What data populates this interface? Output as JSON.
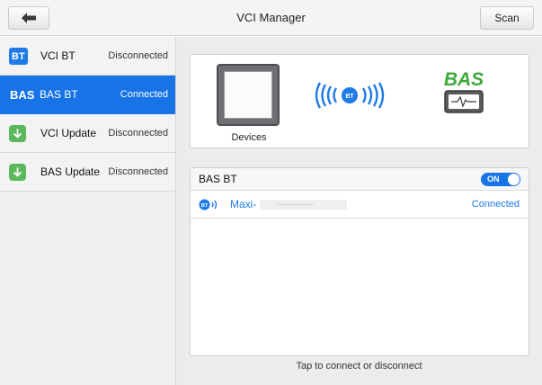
{
  "topbar": {
    "title": "VCI Manager",
    "back_icon": "arrow-left-icon",
    "scan_label": "Scan"
  },
  "sidebar": {
    "items": [
      {
        "icon_text": "BT",
        "icon": "bluetooth-badge-icon",
        "label": "VCI BT",
        "status": "Disconnected",
        "active": false
      },
      {
        "icon_text": "BAS",
        "icon": "bas-badge-icon",
        "label": "BAS BT",
        "status": "Connected",
        "active": true
      },
      {
        "icon": "download-arrow-icon",
        "label": "VCI Update",
        "status": "Disconnected",
        "active": false
      },
      {
        "icon": "download-arrow-icon",
        "label": "BAS Update",
        "status": "Disconnected",
        "active": false
      }
    ]
  },
  "devices": {
    "label": "Devices",
    "signal_icon": "bluetooth-signal-icon",
    "bas_logo_text": "BAS",
    "bas_logo_icon": "battery-tester-icon"
  },
  "bt_panel": {
    "header_label": "BAS BT",
    "toggle_label": "ON",
    "device": {
      "icon": "bluetooth-device-icon",
      "name": "Maxi-",
      "status": "Connected"
    }
  },
  "hint": "Tap to connect or disconnect",
  "colors": {
    "accent": "#1773e6",
    "link": "#1e7be8",
    "bas_green": "#3faa3a",
    "update_green": "#5cb85c"
  }
}
